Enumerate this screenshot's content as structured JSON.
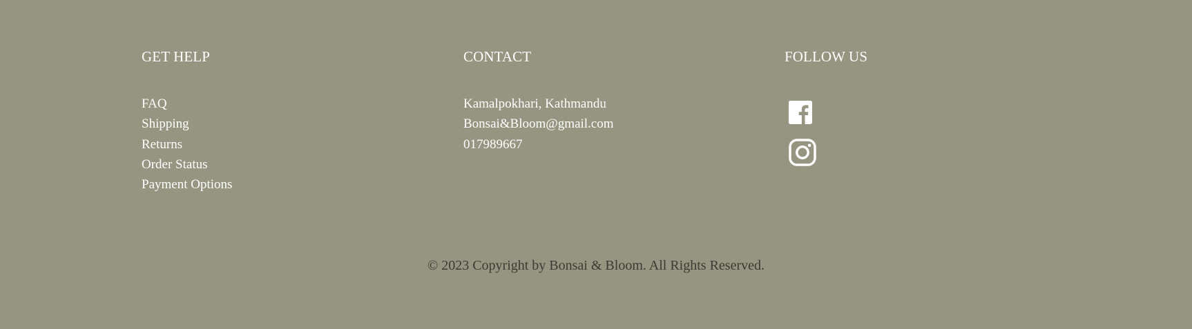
{
  "footer": {
    "get_help": {
      "title": "GET HELP",
      "links": [
        "FAQ",
        "Shipping",
        "Returns",
        "Order Status",
        "Payment Options"
      ]
    },
    "contact": {
      "title": "CONTACT",
      "lines": [
        "Kamalpokhari, Kathmandu",
        "Bonsai&Bloom@gmail.com",
        "017989667"
      ]
    },
    "follow_us": {
      "title": "FOLLOW US",
      "icons": [
        "facebook-icon",
        "instagram-icon"
      ]
    },
    "copyright": "© 2023 Copyright by Bonsai & Bloom. All Rights Reserved."
  },
  "colors": {
    "background": "#959581",
    "heading_text": "#ffffff",
    "copyright_text": "#3b3b34"
  }
}
